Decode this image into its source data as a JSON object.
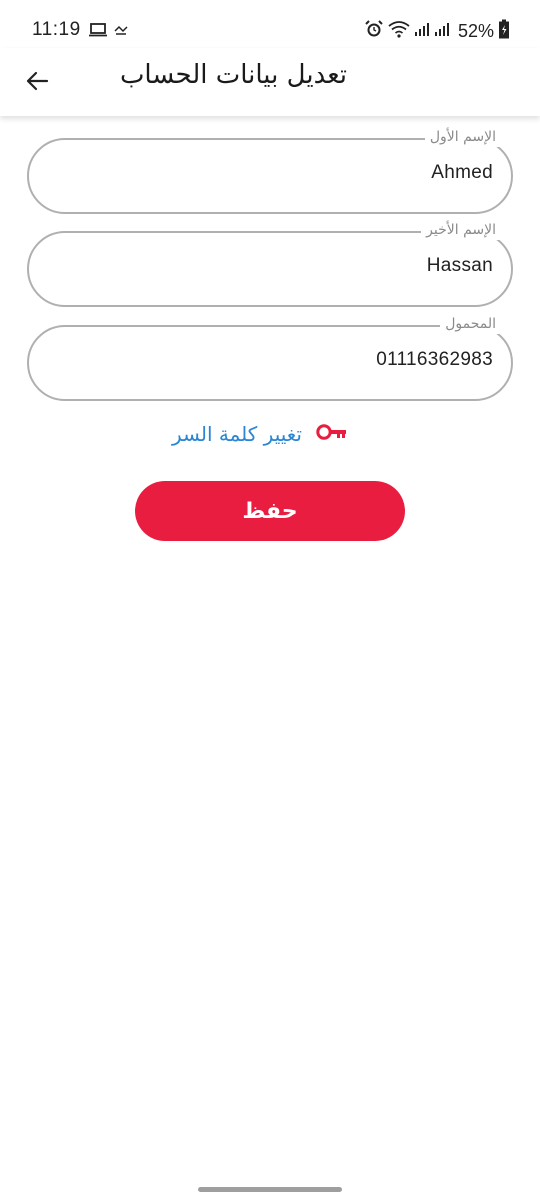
{
  "status_bar": {
    "time": "11:19",
    "battery": "52%",
    "icons": [
      "laptop-icon",
      "notification-icon",
      "alarm-icon",
      "wifi-icon",
      "signal-icon",
      "signal-icon",
      "battery-icon"
    ]
  },
  "app_bar": {
    "title": "تعديل بيانات الحساب",
    "back_icon": "back-arrow-icon"
  },
  "form": {
    "first_name": {
      "label": "الإسم الأول",
      "value": "Ahmed"
    },
    "last_name": {
      "label": "الإسم الأخير",
      "value": "Hassan"
    },
    "mobile": {
      "label": "المحمول",
      "value": "01116362983"
    }
  },
  "change_password": {
    "label": "تغيير كلمة السر",
    "icon": "key-icon",
    "icon_color": "#e91d3f",
    "link_color": "#2a86d4"
  },
  "save_button": {
    "label": "حفظ",
    "color": "#e91d3f"
  }
}
